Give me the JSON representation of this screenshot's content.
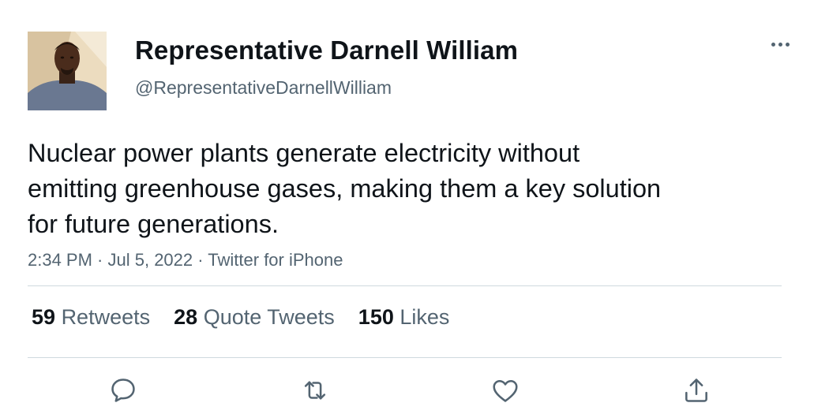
{
  "author": {
    "display_name": "Representative Darnell William",
    "handle": "@RepresentativeDarnellWilliam",
    "avatar_icon": "profile-photo"
  },
  "tweet": {
    "lines": [
      "Nuclear power plants generate electricity without",
      "emitting greenhouse gases, making them a key solution",
      "for future generations."
    ],
    "time": "2:34 PM",
    "date": "Jul 5, 2022",
    "source": "Twitter for iPhone",
    "separator": " · "
  },
  "stats": {
    "retweets": {
      "count": "59",
      "label": "Retweets"
    },
    "quotes": {
      "count": "28",
      "label": "Quote Tweets"
    },
    "likes": {
      "count": "150",
      "label": "Likes"
    }
  },
  "icons": {
    "more": "more-horizontal-icon",
    "reply": "reply-icon",
    "retweet": "retweet-icon",
    "like": "heart-icon",
    "share": "share-icon"
  },
  "colors": {
    "text": "#0f1419",
    "secondary": "#536471",
    "divider": "#cfd9de"
  }
}
